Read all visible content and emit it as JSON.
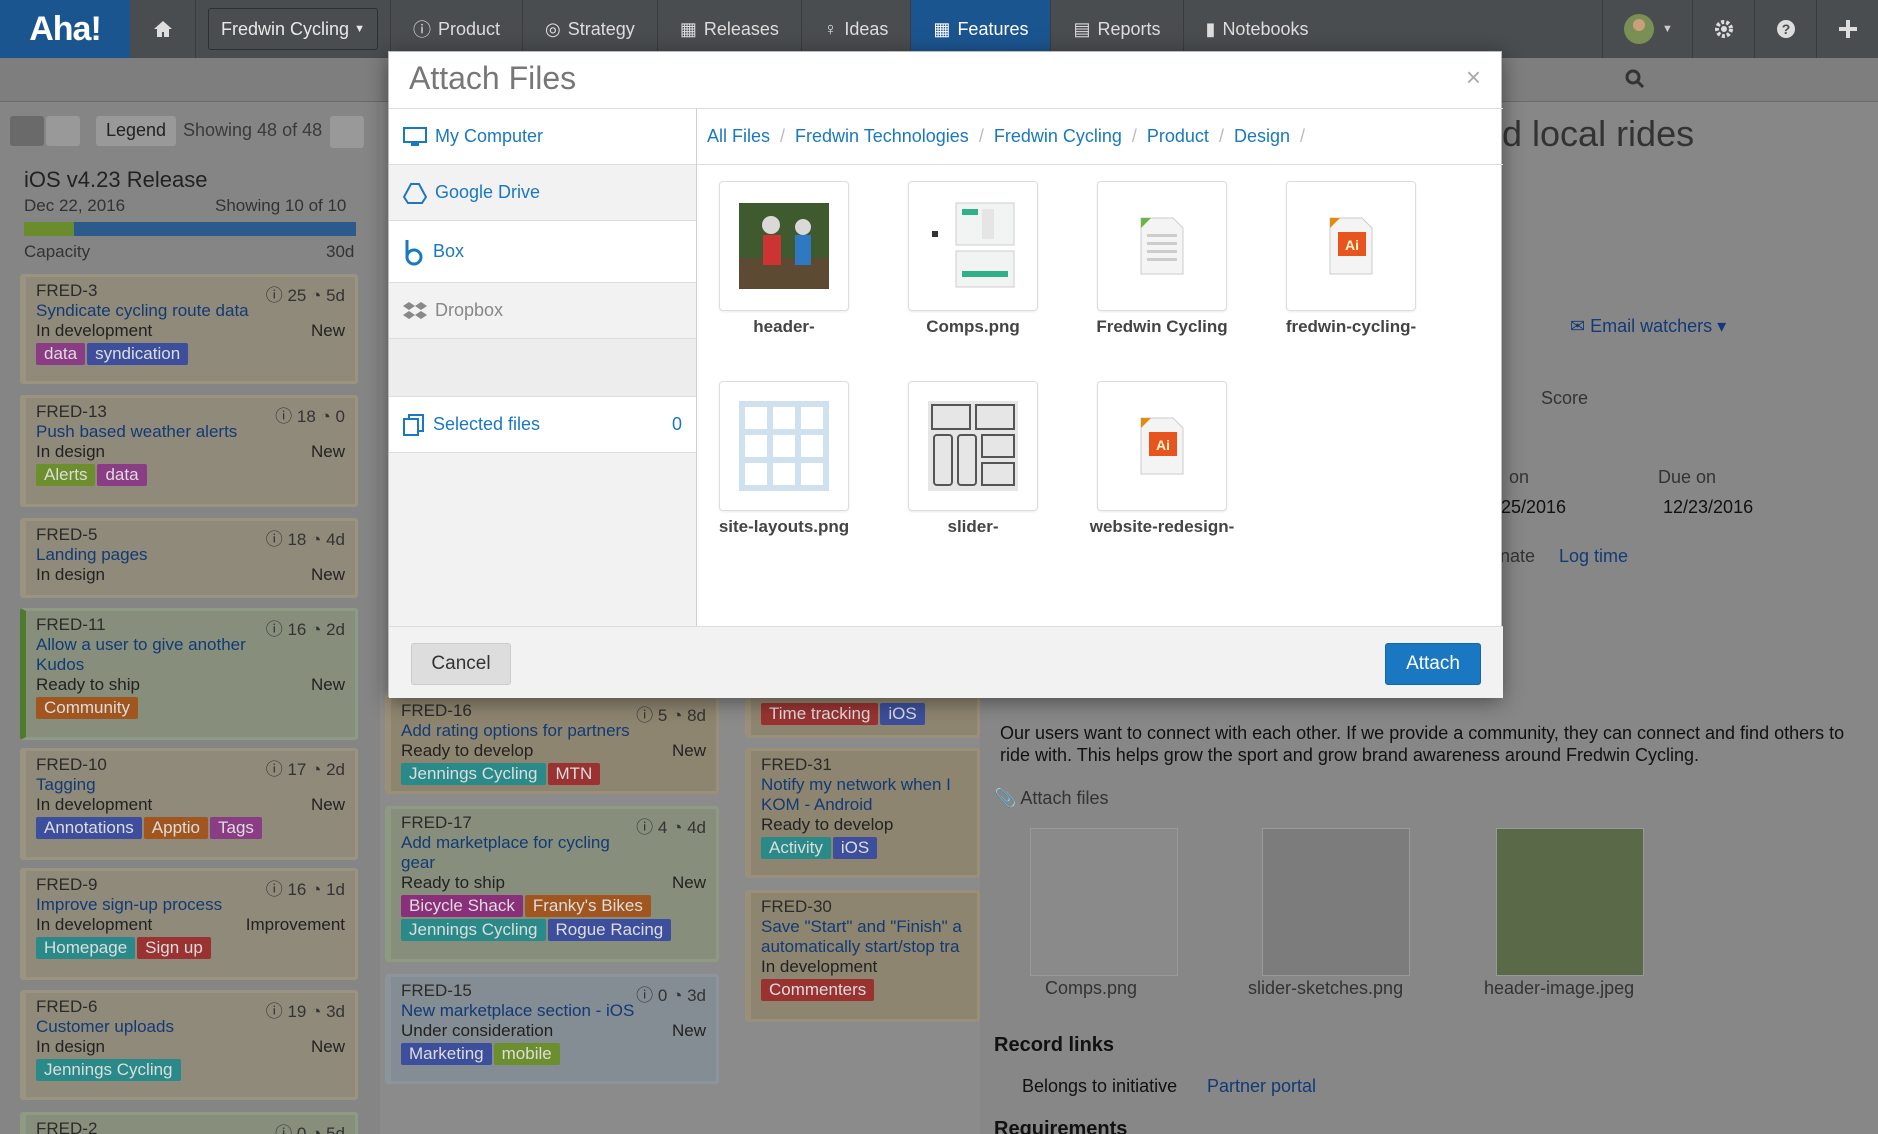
{
  "nav": {
    "logo": "Aha!",
    "workspace": "Fredwin Cycling",
    "items": [
      "Product",
      "Strategy",
      "Releases",
      "Ideas",
      "Features",
      "Reports",
      "Notebooks"
    ],
    "active": "Features"
  },
  "toolbar": {
    "legend": "Legend",
    "showing": "Showing 48 of 48"
  },
  "release": {
    "name": "iOS v4.23 Release",
    "date": "Dec 22, 2016",
    "showing": "Showing 10 of 10",
    "capacity_label": "Capacity",
    "capacity_value": "30d"
  },
  "cards": [
    {
      "id": "FRED-3",
      "count": "25",
      "time": "5d",
      "title": "Syndicate cycling route data",
      "status": "In development",
      "right": "New",
      "tags": [
        "data",
        "syndication"
      ]
    },
    {
      "id": "FRED-13",
      "count": "18",
      "time": "0",
      "title": "Push based weather alerts",
      "status": "In design",
      "right": "New",
      "tags": [
        "Alerts",
        "data"
      ]
    },
    {
      "id": "FRED-5",
      "count": "18",
      "time": "4d",
      "title": "Landing pages",
      "status": "In design",
      "right": "New",
      "tags": []
    },
    {
      "id": "FRED-11",
      "count": "16",
      "time": "2d",
      "title": "Allow a user to give another Kudos",
      "status": "Ready to ship",
      "right": "New",
      "tags": [
        "Community"
      ]
    },
    {
      "id": "FRED-10",
      "count": "17",
      "time": "2d",
      "title": "Tagging",
      "status": "In development",
      "right": "New",
      "tags": [
        "Annotations",
        "Apptio",
        "Tags"
      ]
    },
    {
      "id": "FRED-9",
      "count": "16",
      "time": "1d",
      "title": "Improve sign-up process",
      "status": "In development",
      "right": "Improvement",
      "tags": [
        "Homepage",
        "Sign up"
      ]
    },
    {
      "id": "FRED-6",
      "count": "19",
      "time": "3d",
      "title": "Customer uploads",
      "status": "In design",
      "right": "New",
      "tags": [
        "Jennings Cycling"
      ]
    },
    {
      "id": "FRED-2",
      "count": "0",
      "time": "5d",
      "title": "",
      "status": "",
      "right": "",
      "tags": []
    }
  ],
  "cards_mid": [
    {
      "id": "FRED-16",
      "count": "5",
      "time": "8d",
      "title": "Add rating options for partners",
      "status": "Ready to develop",
      "right": "New",
      "tags": [
        "Jennings Cycling",
        "MTN"
      ]
    },
    {
      "id": "FRED-17",
      "count": "4",
      "time": "4d",
      "title": "Add marketplace for cycling gear",
      "status": "Ready to ship",
      "right": "New",
      "tags": [
        "Bicycle Shack",
        "Franky's Bikes",
        "Jennings Cycling",
        "Rogue Racing"
      ]
    },
    {
      "id": "FRED-15",
      "count": "0",
      "time": "3d",
      "title": "New marketplace section - iOS",
      "status": "Under consideration",
      "right": "New",
      "tags": [
        "Marketing",
        "mobile"
      ]
    }
  ],
  "cards_col3": [
    {
      "id": "",
      "title": "",
      "tags": [
        "Time tracking",
        "iOS"
      ]
    },
    {
      "id": "FRED-31",
      "title": "Notify my network when I KOM - Android",
      "status": "Ready to develop",
      "tags": [
        "Activity",
        "iOS"
      ]
    },
    {
      "id": "FRED-30",
      "title": "Save \"Start\" and \"Finish\" a automatically start/stop tra",
      "status": "In development",
      "tags": [
        "Commenters"
      ]
    }
  ],
  "detail": {
    "title_fragment": "d local rides",
    "watchers": "Email watchers",
    "score": "Score",
    "start_label": "on",
    "start": "25/2016",
    "due_label": "Due on",
    "due": "12/23/2016",
    "estimate": "nate",
    "log_time": "Log time",
    "description": "Our users want to connect with each other. If we provide a community, they can connect and find others to ride with. This helps grow the sport and grow brand awareness around Fredwin Cycling.",
    "attach_files": "Attach files",
    "attachments": [
      "Comps.png",
      "slider-sketches.png",
      "header-image.jpeg"
    ],
    "record_links": "Record links",
    "belongs": "Belongs to initiative",
    "initiative": "Partner portal",
    "requirements": "Requirements"
  },
  "modal": {
    "title": "Attach Files",
    "close": "×",
    "sources": [
      "My Computer",
      "Google Drive",
      "Box",
      "Dropbox"
    ],
    "selected_label": "Selected files",
    "selected_count": "0",
    "breadcrumbs": [
      "All Files",
      "Fredwin Technologies",
      "Fredwin Cycling",
      "Product",
      "Design"
    ],
    "files": [
      "header-",
      "Comps.png",
      "Fredwin Cycling",
      "fredwin-cycling-",
      "site-layouts.png",
      "slider-",
      "website-redesign-"
    ],
    "cancel": "Cancel",
    "attach": "Attach"
  },
  "colors": {
    "accent": "#1a78c2",
    "nav": "#4a4d50",
    "logo": "#1b5590"
  }
}
